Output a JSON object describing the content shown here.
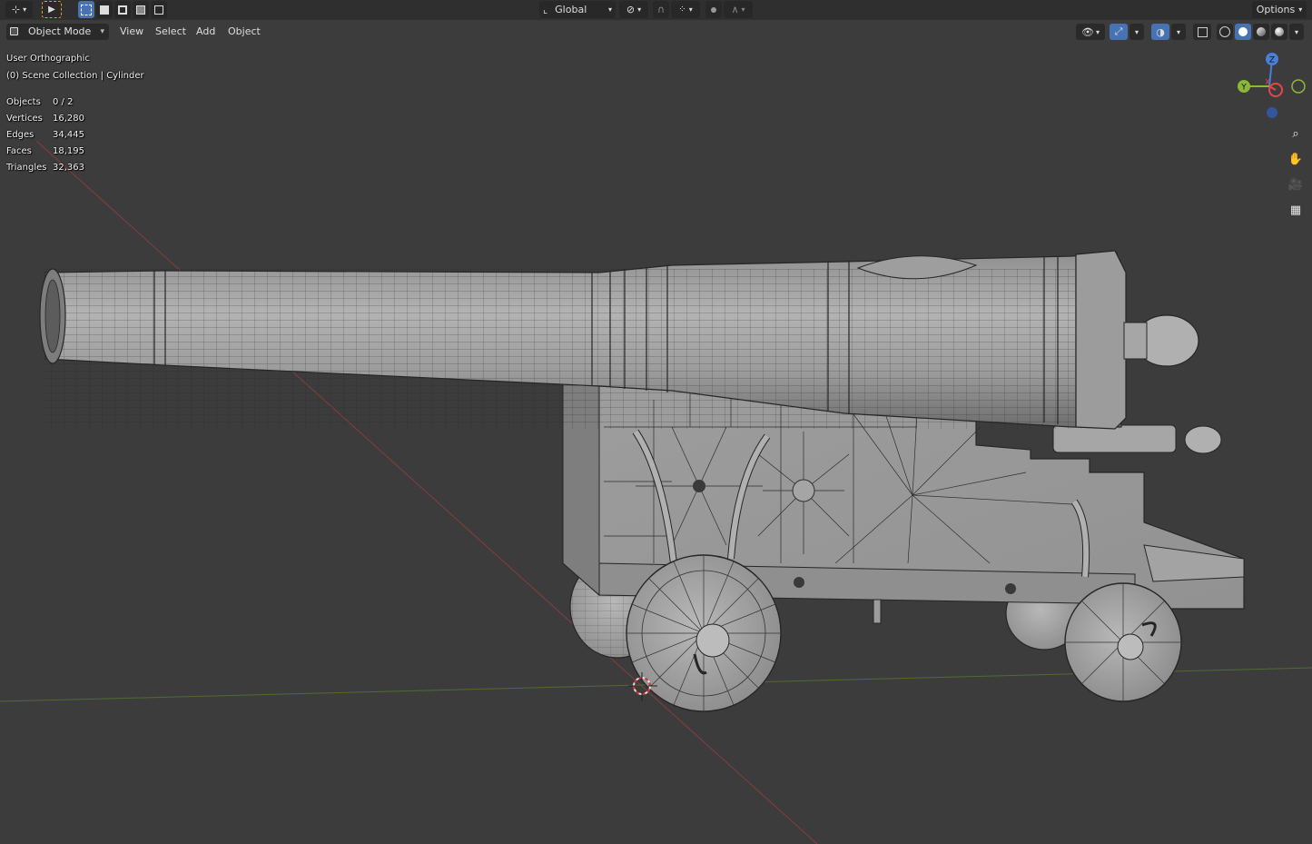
{
  "header": {
    "transform_orientation": "Global",
    "options_label": "Options"
  },
  "menubar": {
    "mode": "Object Mode",
    "items": [
      "View",
      "Select",
      "Add",
      "Object"
    ]
  },
  "overlay": {
    "view_name": "User Orthographic",
    "collection_info": "(0) Scene Collection | Cylinder",
    "stats": [
      {
        "label": "Objects",
        "value": "0 / 2"
      },
      {
        "label": "Vertices",
        "value": "16,280"
      },
      {
        "label": "Edges",
        "value": "34,445"
      },
      {
        "label": "Faces",
        "value": "18,195"
      },
      {
        "label": "Triangles",
        "value": "32,363"
      }
    ]
  },
  "gizmo": {
    "axis_labels": {
      "z": "Z",
      "y": "Y",
      "x": "X"
    },
    "colors": {
      "x": "#e4464f",
      "y": "#8bb83a",
      "z": "#4a7fd8"
    }
  },
  "icons": {
    "editor_type": "viewport-icon",
    "select_tool": "cursor-icon",
    "zoom": "zoom-icon",
    "pan": "hand-icon",
    "camera": "camera-icon",
    "grid": "grid-icon"
  },
  "colors": {
    "viewport_bg": "#3c3c3c",
    "header_bg": "#2f2f2f",
    "accent": "#4772b3",
    "mesh_fill": "#9a9a9a",
    "wire": "#262626"
  }
}
